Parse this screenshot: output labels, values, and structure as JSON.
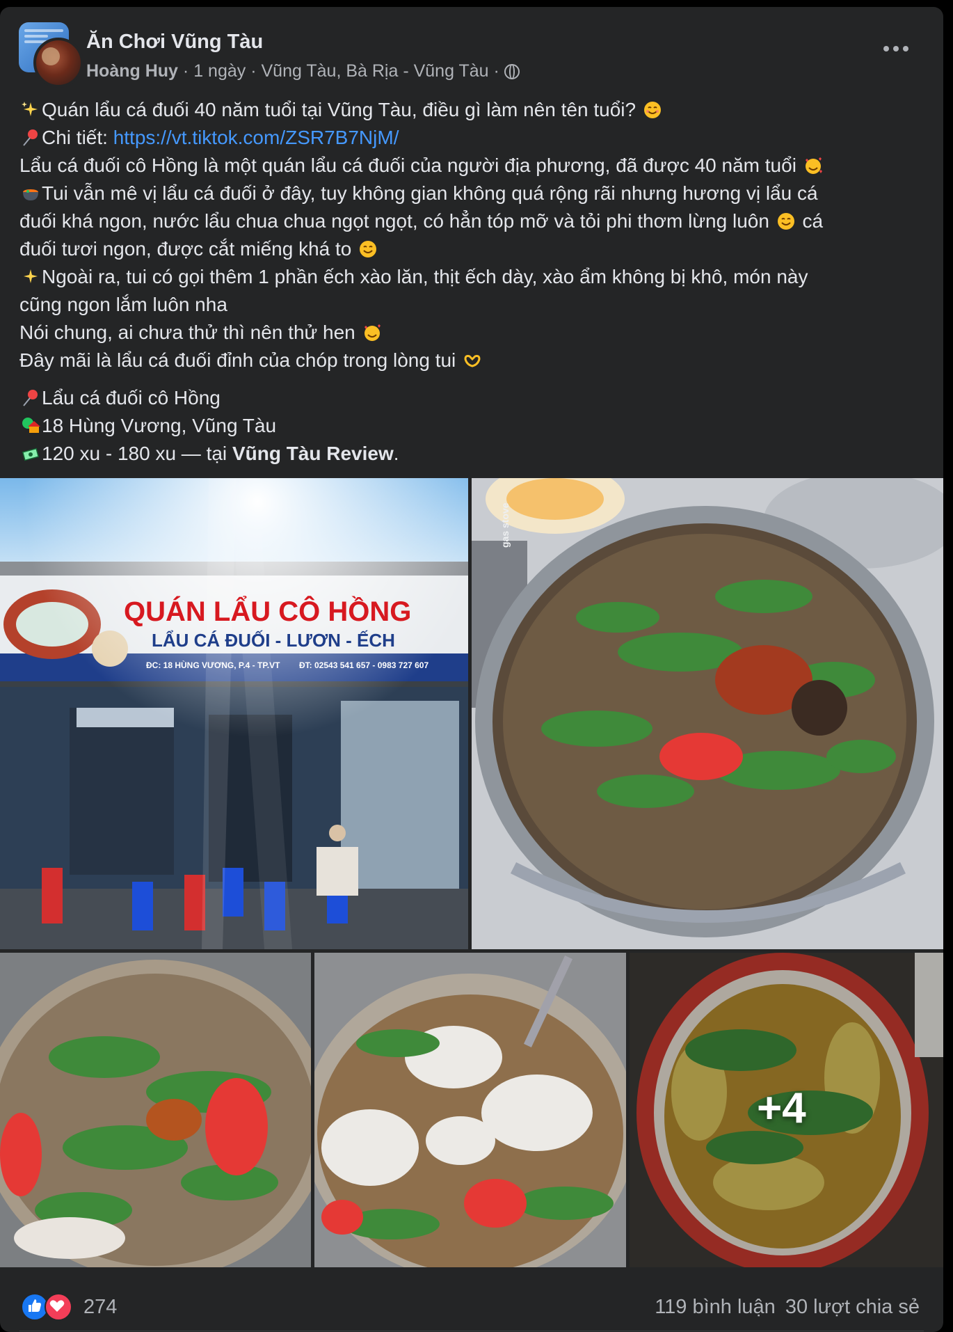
{
  "post": {
    "group_name": "Ăn Chơi Vũng Tàu",
    "author": "Hoàng Huy",
    "time": "1 ngày",
    "location": "Vũng Tàu, Bà Rịa - Vũng Tàu",
    "separator": "·",
    "more_icon": "more-horizontal-icon",
    "privacy_icon": "globe-icon"
  },
  "content": {
    "l1": "Quán lẩu cá đuối 40 năm tuổi tại Vũng Tàu, điều gì làm nên tên tuổi?",
    "l2_prefix": "Chi tiết: ",
    "l2_link": "https://vt.tiktok.com/ZSR7B7NjM/",
    "l3": "Lẩu cá đuối cô Hồng là một quán lẩu cá đuối của người địa phương, đã được 40 năm tuổi",
    "l4": "Tui vẫn mê vị lẩu cá đuối ở đây, tuy không gian không quá rộng rãi nhưng hương vị lẩu cá",
    "l5": "đuối khá ngon, nước lẩu chua chua ngọt ngọt, có hẳn tóp mỡ và tỏi phi thơm lừng luôn",
    "l5_tail": " cá",
    "l6": "đuối tươi ngon, được cắt miếng khá to",
    "l7": "Ngoài ra, tui có gọi thêm 1 phần ếch xào lăn, thịt ếch dày, xào ẩm không bị khô, món này",
    "l8": "cũng ngon lắm luôn nha",
    "l9": "Nói chung, ai chưa thử thì nên thử hen",
    "l10": "Đây mãi là lẩu cá đuối đỉnh của chóp trong lòng tui",
    "l11": "Lẩu cá đuối cô Hồng",
    "l12": "18 Hùng Vương, Vũng Tàu",
    "l13_prefix": "120 xu - 180 xu — tại ",
    "l13_bold": "Vũng Tàu Review",
    "l13_suffix": "."
  },
  "photos": {
    "sign_title": "QUÁN LẨU CÔ HỒNG",
    "sign_sub": "LẨU CÁ ĐUỐI - LƯƠN - ẾCH",
    "sign_addr": "ĐC: 18 HÙNG VƯƠNG, P.4 - TP.VT",
    "sign_phone": "ĐT: 02543 541 657 - 0983 727 607",
    "stove_label": "gas stove",
    "more_count": "+4"
  },
  "footer": {
    "reactions": "274",
    "comments": "119 bình luận",
    "shares": "30 lượt chia sẻ",
    "like_color": "#1877f2",
    "love_color": "#f33e58"
  }
}
